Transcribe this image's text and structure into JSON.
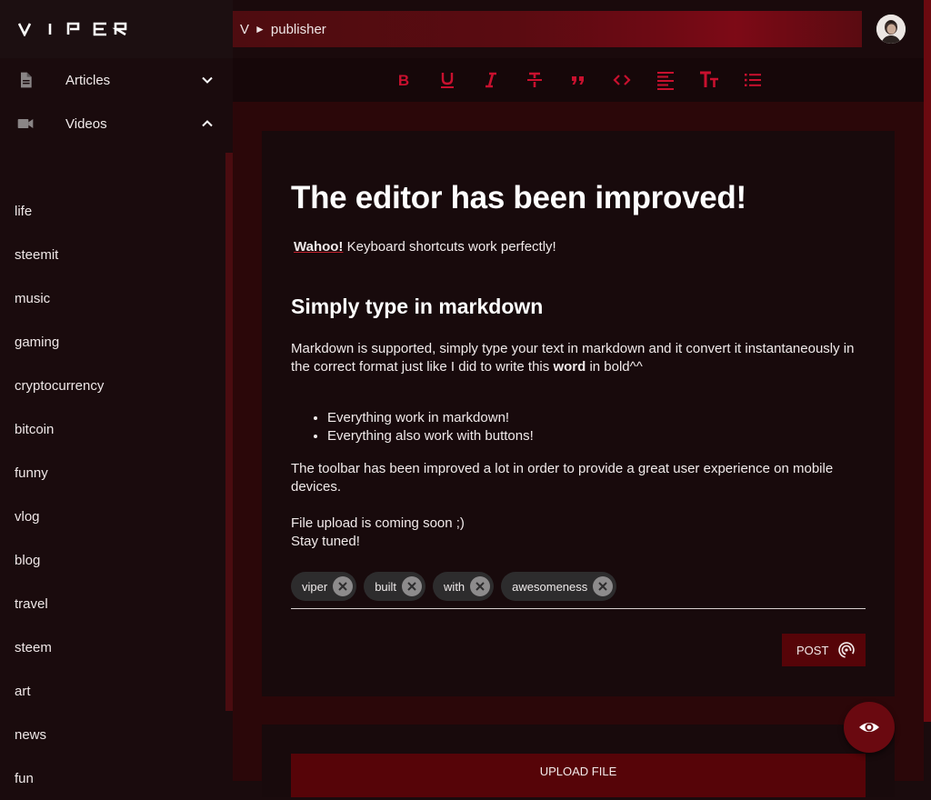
{
  "brand": {
    "name": "VIPER"
  },
  "header": {
    "breadcrumb": [
      "V",
      "publisher"
    ],
    "breadcrumb_separator": "►"
  },
  "sidebar": {
    "sections": [
      {
        "label": "Articles",
        "icon": "document-icon",
        "expanded": false
      },
      {
        "label": "Videos",
        "icon": "videocam-icon",
        "expanded": true
      }
    ],
    "tags": [
      "life",
      "steemit",
      "music",
      "gaming",
      "cryptocurrency",
      "bitcoin",
      "funny",
      "vlog",
      "blog",
      "travel",
      "steem",
      "art",
      "news",
      "fun"
    ]
  },
  "toolbar": {
    "buttons": [
      "bold-icon",
      "underline-icon",
      "italic-icon",
      "strikethrough-icon",
      "quote-icon",
      "code-icon",
      "align-left-icon",
      "text-size-icon",
      "list-icon"
    ],
    "icon_color": "#c8102e"
  },
  "editor": {
    "title": "The editor has been improved!",
    "intro_bold": "Wahoo!",
    "intro_rest": " Keyboard shortcuts work perfectly!",
    "heading": "Simply type in markdown",
    "para1_before": "Markdown is supported, simply type your text in markdown and it convert it instantaneously in the correct format just like I did to write this ",
    "para1_bold": "word",
    "para1_after": " in bold^^",
    "bullets": [
      "Everything work in markdown!",
      "Everything also work with buttons!"
    ],
    "para2": "The toolbar has been improved a lot in order to provide a great user experience on mobile devices.",
    "para3": "File upload is coming soon ;)",
    "para4": "Stay tuned!"
  },
  "tags": [
    "viper",
    "built",
    "with",
    "awesomeness"
  ],
  "actions": {
    "post_label": "POST",
    "upload_label": "UPLOAD FILE",
    "preview_icon": "eye-icon"
  },
  "colors": {
    "accent": "#560408",
    "background": "#180a0c"
  }
}
